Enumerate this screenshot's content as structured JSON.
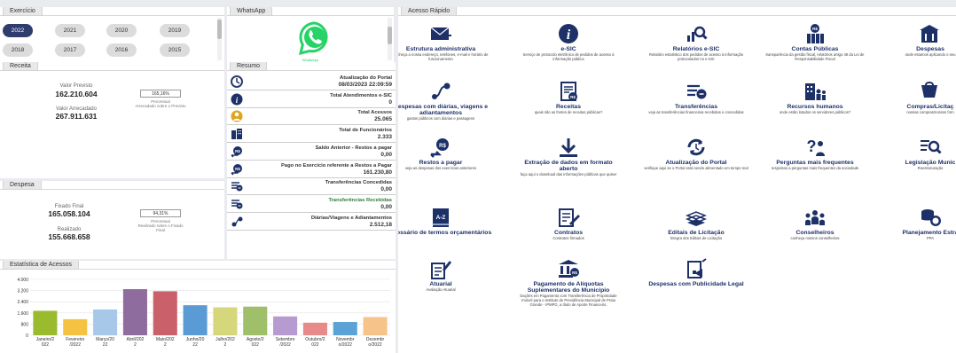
{
  "exercicio": {
    "tab": "Exercício",
    "years": [
      "2022",
      "2021",
      "2020",
      "2019",
      "2018",
      "2017",
      "2016",
      "2015"
    ],
    "selected": "2022"
  },
  "whatsapp": {
    "tab": "WhatsApp",
    "caption": "WhatsApp"
  },
  "receita": {
    "tab": "Receita",
    "previsto_label": "Valor Previsto",
    "previsto_value": "162.210.604",
    "arrecadado_label": "Valor Arrecadado",
    "arrecadado_value": "267.911.631",
    "pct": "165,16%",
    "pct_label": "Percentual",
    "pct_desc": "Arrecadado sobre o Previsto"
  },
  "despesa": {
    "tab": "Despesa",
    "fixado_label": "Fixado Final",
    "fixado_value": "165.058.104",
    "realizado_label": "Realizado",
    "realizado_value": "155.668.658",
    "pct": "94,31%",
    "pct_label": "Percentual",
    "pct_desc": "Realizado sobre o Fixado Final"
  },
  "resumo": {
    "tab": "Resumo",
    "rows": [
      {
        "title": "Atualização do Portal",
        "value": "08/03/2023 22:09:59"
      },
      {
        "title": "Total Atendimentos e-SIC",
        "value": "0"
      },
      {
        "title": "Total Acessos",
        "value": "25.065"
      },
      {
        "title": "Total de Funcionários",
        "value": "2.333"
      },
      {
        "title": "Saldo Anterior - Restos a pagar",
        "value": "0,00"
      },
      {
        "title": "Pago no Exercício referente a Restos a Pagar",
        "value": "161.230,80"
      },
      {
        "title": "Transferências Concedidas",
        "value": "0,00"
      },
      {
        "title": "Transferências Recebidas",
        "value": "0,00"
      },
      {
        "title": "Diárias/Viagens e Adiantamentos",
        "value": "2.512,18"
      }
    ]
  },
  "acesso": {
    "tab": "Acesso Rápido",
    "items": [
      {
        "icon": "envelope-icon",
        "title": "Estrutura administrativa",
        "sub": "conheça a nossa endereço, telefones, e-mail e horário de funcionamento"
      },
      {
        "icon": "info-icon",
        "title": "e-SIC",
        "sub": "Serviço de protocolo eletrônico de pedidos de acesso à informação pública"
      },
      {
        "icon": "chart-search-icon",
        "title": "Relatórios e-SIC",
        "sub": "Relatório estatístico dos pedidos de acesso à informação protocolados no e-SIC"
      },
      {
        "icon": "public-accounts-icon",
        "title": "Contas Públicas",
        "sub": "transparência da gestão fiscal, relatórios artigo 48 da Lei de Responsabilidade Fiscal"
      },
      {
        "icon": "buildings-money-icon",
        "title": "Despesas",
        "sub": "onde estamos aplicando o seu"
      },
      {
        "icon": "route-icon",
        "title": "Despesas com diárias, viagens e adiantamentos",
        "sub": "gastos públicos com diárias e passagens"
      },
      {
        "icon": "receipt-icon",
        "title": "Receitas",
        "sub": "quais são as fontes de receitas públicas?"
      },
      {
        "icon": "transfer-icon",
        "title": "Transferências",
        "sub": "veja as transferências financeiras recebidas e concedidas"
      },
      {
        "icon": "people-building-icon",
        "title": "Recursos humanos",
        "sub": "onde estão lotados os servidores públicos?"
      },
      {
        "icon": "shopping-icon",
        "title": "Compras/Licitaç",
        "sub": "nossas compras/nossos forn"
      },
      {
        "icon": "money-hand-icon",
        "title": "Restos a pagar",
        "sub": "veja as despesas dos exercícios anteriores"
      },
      {
        "icon": "download-icon",
        "title": "Extração de dados em formato aberto",
        "sub": "faça aqui o download das informações públicas que quiser"
      },
      {
        "icon": "refresh-icon",
        "title": "Atualização do Portal",
        "sub": "verifique aqui se o Portal está sendo alimentado em tempo real"
      },
      {
        "icon": "question-people-icon",
        "title": "Perguntas mais frequentes",
        "sub": "respostas a perguntas mais frequentes da sociedade"
      },
      {
        "icon": "list-search-icon",
        "title": "Legislação Munic",
        "sub": "Reestruturação"
      },
      {
        "icon": "dictionary-icon",
        "title": "Glossário de termos orçamentários",
        "sub": ""
      },
      {
        "icon": "contract-icon",
        "title": "Contratos",
        "sub": "Contratos firmados"
      },
      {
        "icon": "documents-icon",
        "title": "Editais de Licitação",
        "sub": "Íntegra dos Editais de Licitação"
      },
      {
        "icon": "council-icon",
        "title": "Conselheiros",
        "sub": "conheça nossos conselheiros"
      },
      {
        "icon": "coins-icon",
        "title": "Planejamento Estra",
        "sub": "PPA"
      },
      {
        "icon": "actuarial-icon",
        "title": "Atuarial",
        "sub": "Avaliação Atuarial"
      },
      {
        "icon": "institution-money-icon",
        "title": "Pagamento de Alíquotas Suplementares do Município",
        "sub": "Dações em Pagamento com Transferência de Propriedade Imóvel para o Instituto de Previdência Municipal de Praia Grande - IPMPG, a título de Aporte Financeiro."
      },
      {
        "icon": "megaphone-icon",
        "title": "Despesas com Publicidade Legal",
        "sub": ""
      }
    ]
  },
  "estatistica": {
    "tab": "Estatística de Acessos"
  },
  "chart_data": {
    "type": "bar",
    "categories": [
      "Janeiro/2022",
      "Fevereiro/2022",
      "Março/2022",
      "Abril/2022",
      "Maio/2022",
      "Junho/2022",
      "Julho/2022",
      "Agosto/2022",
      "Setembro/2022",
      "Outubro/2022",
      "Novembro/2022",
      "Dezembro/2022"
    ],
    "category_labels": [
      [
        "Janeiro/2",
        "022"
      ],
      [
        "Fevereiro",
        "/2022"
      ],
      [
        "Março/20",
        "22"
      ],
      [
        "Abril/202",
        "2"
      ],
      [
        "Maio/202",
        "2"
      ],
      [
        "Junho/20",
        "22"
      ],
      [
        "Julho/202",
        "2"
      ],
      [
        "Agosto/2",
        "022"
      ],
      [
        "Setembro",
        "/2022"
      ],
      [
        "Outubro/2",
        "022"
      ],
      [
        "Novembr",
        "o/2022"
      ],
      [
        "Dezembr",
        "o/2022"
      ]
    ],
    "values": [
      1750,
      1150,
      1850,
      3300,
      3150,
      2150,
      2000,
      2050,
      1350,
      900,
      950,
      1300
    ],
    "colors": [
      "#9bbb2f",
      "#f5c242",
      "#a8c8ea",
      "#8e6c9e",
      "#c9606a",
      "#5b9bd5",
      "#d6d67a",
      "#9fbf6b",
      "#b79acf",
      "#e88a8a",
      "#5ba3d6",
      "#f6c38a"
    ],
    "yticks": [
      "4.000",
      "3.200",
      "2.400",
      "1.600",
      "800",
      "0"
    ],
    "ylim": [
      0,
      4000
    ]
  }
}
